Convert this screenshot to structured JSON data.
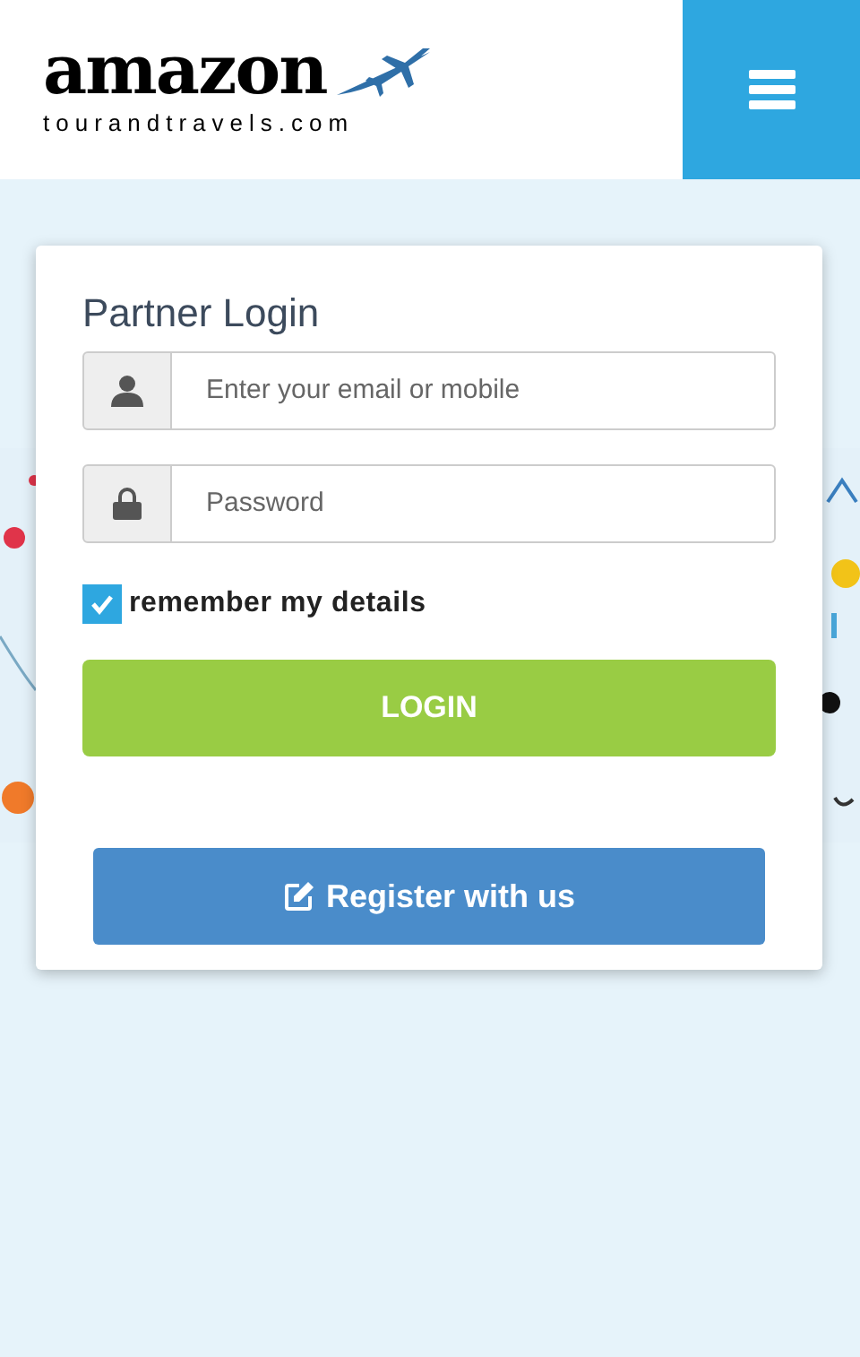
{
  "header": {
    "logo": {
      "name": "amazon",
      "domain": "tourandtravels.com"
    }
  },
  "login_card": {
    "title": "Partner Login",
    "email_field": {
      "placeholder": "Enter your email or mobile"
    },
    "password_field": {
      "placeholder": "Password"
    },
    "remember": {
      "label": "remember my details",
      "checked": true
    },
    "login_button": "LOGIN",
    "register_button": "Register with us"
  }
}
